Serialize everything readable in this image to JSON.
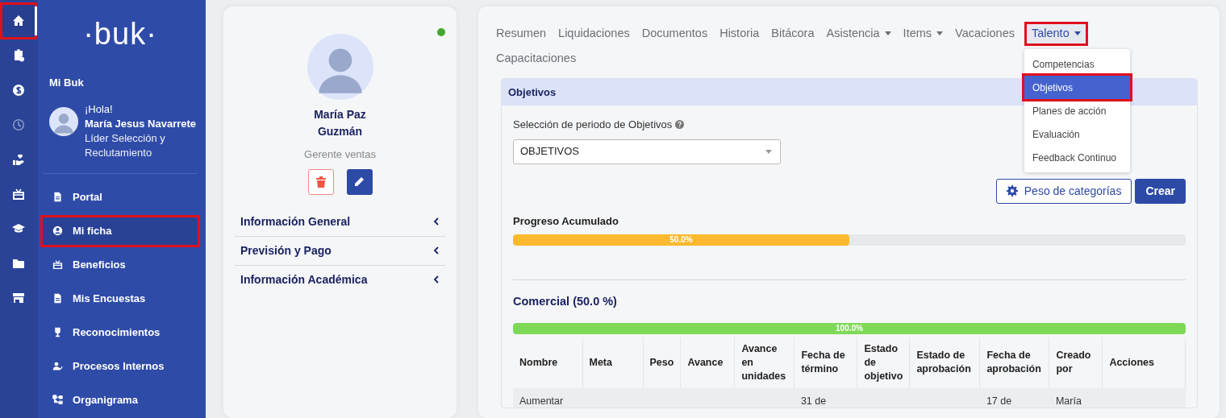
{
  "rail": {
    "icons": [
      {
        "kind": "home",
        "selected": true,
        "disabled": false,
        "highlighted": true
      },
      {
        "kind": "clipboard",
        "selected": false,
        "disabled": false,
        "highlighted": false
      },
      {
        "kind": "dollar",
        "selected": false,
        "disabled": false,
        "highlighted": false
      },
      {
        "kind": "clock",
        "selected": false,
        "disabled": true,
        "highlighted": false
      },
      {
        "kind": "hand-heart",
        "selected": false,
        "disabled": false,
        "highlighted": false
      },
      {
        "kind": "gift",
        "selected": false,
        "disabled": false,
        "highlighted": false
      },
      {
        "kind": "graduation",
        "selected": false,
        "disabled": false,
        "highlighted": false
      },
      {
        "kind": "folder",
        "selected": false,
        "disabled": false,
        "highlighted": false
      },
      {
        "kind": "store",
        "selected": false,
        "disabled": false,
        "highlighted": false
      }
    ]
  },
  "sidebar": {
    "logo": "·buk·",
    "section": "Mi Buk",
    "greeting": "¡Hola!",
    "user_name": "María Jesus Navarrete",
    "user_role": "Líder Selección y Reclutamiento",
    "items": [
      {
        "label": "Portal",
        "kind": "document",
        "selected": false,
        "highlighted": false
      },
      {
        "label": "Mi ficha",
        "kind": "user",
        "selected": true,
        "highlighted": true
      },
      {
        "label": "Beneficios",
        "kind": "gift",
        "selected": false,
        "highlighted": false
      },
      {
        "label": "Mis Encuestas",
        "kind": "document",
        "selected": false,
        "highlighted": false
      },
      {
        "label": "Reconocimientos",
        "kind": "trophy",
        "selected": false,
        "highlighted": false
      },
      {
        "label": "Procesos Internos",
        "kind": "user-check",
        "selected": false,
        "highlighted": false
      },
      {
        "label": "Organigrama",
        "kind": "org",
        "selected": false,
        "highlighted": false
      }
    ]
  },
  "profile": {
    "online": true,
    "name": "María Paz Guzmán",
    "position": "Gerente ventas",
    "sections": [
      {
        "label": "Información General",
        "expanded": false
      },
      {
        "label": "Previsión y Pago",
        "expanded": false
      },
      {
        "label": "Información Académica",
        "expanded": false
      }
    ]
  },
  "tabs": [
    {
      "label": "Resumen",
      "dropdown": false,
      "selected": false,
      "highlighted": false
    },
    {
      "label": "Liquidaciones",
      "dropdown": false,
      "selected": false,
      "highlighted": false
    },
    {
      "label": "Documentos",
      "dropdown": false,
      "selected": false,
      "highlighted": false
    },
    {
      "label": "Historia",
      "dropdown": false,
      "selected": false,
      "highlighted": false
    },
    {
      "label": "Bitácora",
      "dropdown": false,
      "selected": false,
      "highlighted": false
    },
    {
      "label": "Asistencia",
      "dropdown": true,
      "selected": false,
      "highlighted": false
    },
    {
      "label": "Items",
      "dropdown": true,
      "selected": false,
      "highlighted": false
    },
    {
      "label": "Vacaciones",
      "dropdown": false,
      "selected": false,
      "highlighted": false
    },
    {
      "label": "Talento",
      "dropdown": true,
      "selected": true,
      "highlighted": true,
      "menu": [
        {
          "label": "Competencias",
          "selected": false,
          "highlighted": false
        },
        {
          "label": "Objetivos",
          "selected": true,
          "highlighted": true
        },
        {
          "label": "Planes de acción",
          "selected": false,
          "highlighted": false
        },
        {
          "label": "Evaluación",
          "selected": false,
          "highlighted": false
        },
        {
          "label": "Feedback Continuo",
          "selected": false,
          "highlighted": false
        }
      ]
    },
    {
      "label": "Capacitaciones",
      "dropdown": false,
      "selected": false,
      "highlighted": false
    }
  ],
  "panel": {
    "title": "Objetivos",
    "period_label": "Selección de periodo de Objetivos",
    "period_value": "OBJETIVOS",
    "buttons": [
      {
        "label": "Peso de categorías",
        "kind": "outline"
      },
      {
        "label": "Crear",
        "kind": "primary"
      }
    ],
    "progress": {
      "label": "Progreso Acumulado",
      "level": 0.5,
      "reading": "50.0%"
    },
    "category": {
      "title": "Comercial (50.0 %)",
      "level": 1,
      "reading": "100.0%"
    },
    "table": {
      "columns": [
        "Nombre",
        "Meta",
        "Peso",
        "Avance",
        "Avance en unidades",
        "Fecha de término",
        "Estado de objetivo",
        "Estado de aprobación",
        "Fecha de aprobación",
        "Creado por",
        "Acciones"
      ],
      "rows": [
        [
          "Aumentar",
          "",
          "",
          "",
          "",
          "31 de",
          "",
          "",
          "17 de",
          "María",
          ""
        ]
      ]
    }
  }
}
